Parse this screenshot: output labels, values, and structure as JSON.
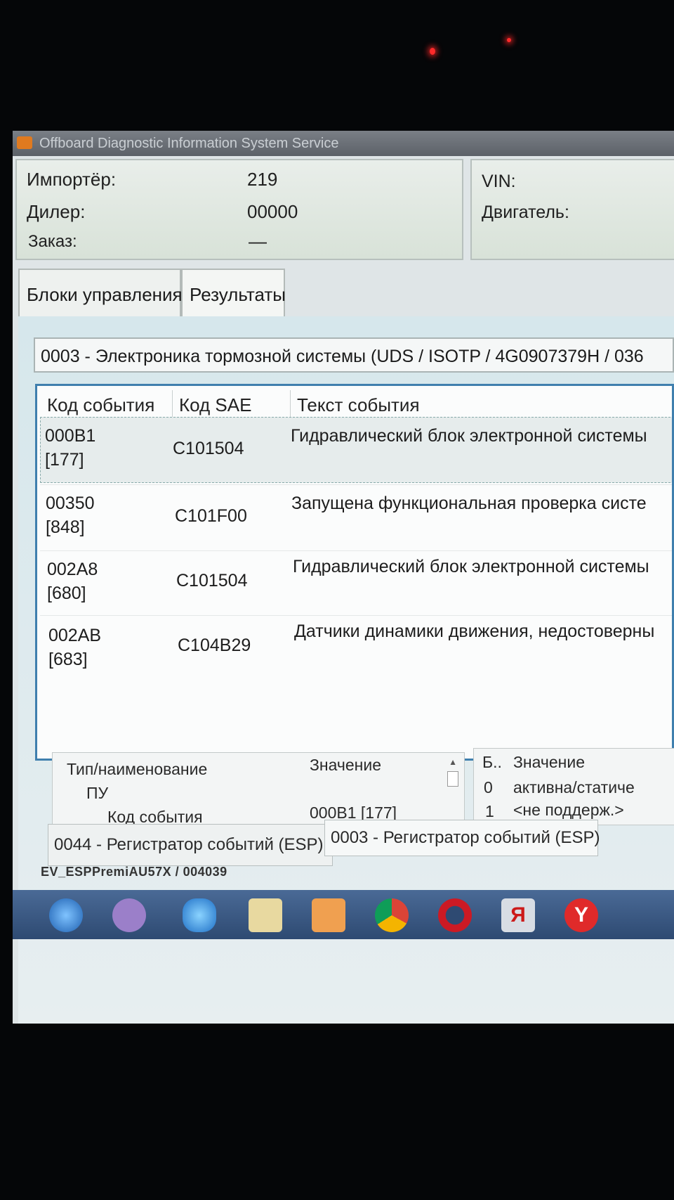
{
  "window": {
    "title": "Offboard Diagnostic Information System Service"
  },
  "info": {
    "importer_label": "Импортёр:",
    "importer_value": "219",
    "dealer_label": "Дилер:",
    "dealer_value": "00000",
    "order_label": "Заказ:",
    "order_value": "—",
    "vin_label": "VIN:",
    "engine_label": "Двигатель:"
  },
  "tabs": [
    {
      "label": "Блоки управления"
    },
    {
      "label": "Результаты"
    }
  ],
  "module": {
    "text": "0003 - Электроника тормозной системы  (UDS / ISOTP / 4G0907379H  / 036"
  },
  "events_table": {
    "headers": [
      "Код события",
      "Код SAE",
      "Текст события"
    ],
    "rows": [
      {
        "code": "000B1",
        "num": "[177]",
        "sae": "C101504",
        "text": "Гидравлический блок электронной системы"
      },
      {
        "code": "00350",
        "num": "[848]",
        "sae": "C101F00",
        "text": "Запущена функциональная проверка систе"
      },
      {
        "code": "002A8",
        "num": "[680]",
        "sae": "C101504",
        "text": "Гидравлический блок электронной системы"
      },
      {
        "code": "002AB",
        "num": "[683]",
        "sae": "C104B29",
        "text": "Датчики динамики движения, недостоверны"
      }
    ]
  },
  "details_left": {
    "col_type": "Тип/наименование",
    "col_value": "Значение",
    "item_pu": "ПУ",
    "item_event_code": "Код события",
    "item_event_value": "000B1 [177]"
  },
  "details_right": {
    "col_b": "Б..",
    "col_value": "Значение",
    "rows": [
      {
        "b": "0",
        "value": "активна/статиче"
      },
      {
        "b": "1",
        "value": "<не поддерж.>"
      }
    ]
  },
  "bottom_tabs": [
    {
      "label": "0044 - Регистратор событий (ESP)"
    },
    {
      "label": "0003 - Регистратор событий (ESP)"
    }
  ],
  "status": {
    "text": "EV_ESPPremiAU57X / 004039"
  },
  "taskbar": {
    "icons": [
      "start-orb-icon",
      "microphone-icon",
      "internet-explorer-icon",
      "file-explorer-icon",
      "media-player-icon",
      "chrome-icon",
      "opera-icon",
      "yandex-icon",
      "yandex-browser-icon"
    ],
    "yandex_glyph": "Я",
    "yandex_browser_glyph": "Y"
  }
}
